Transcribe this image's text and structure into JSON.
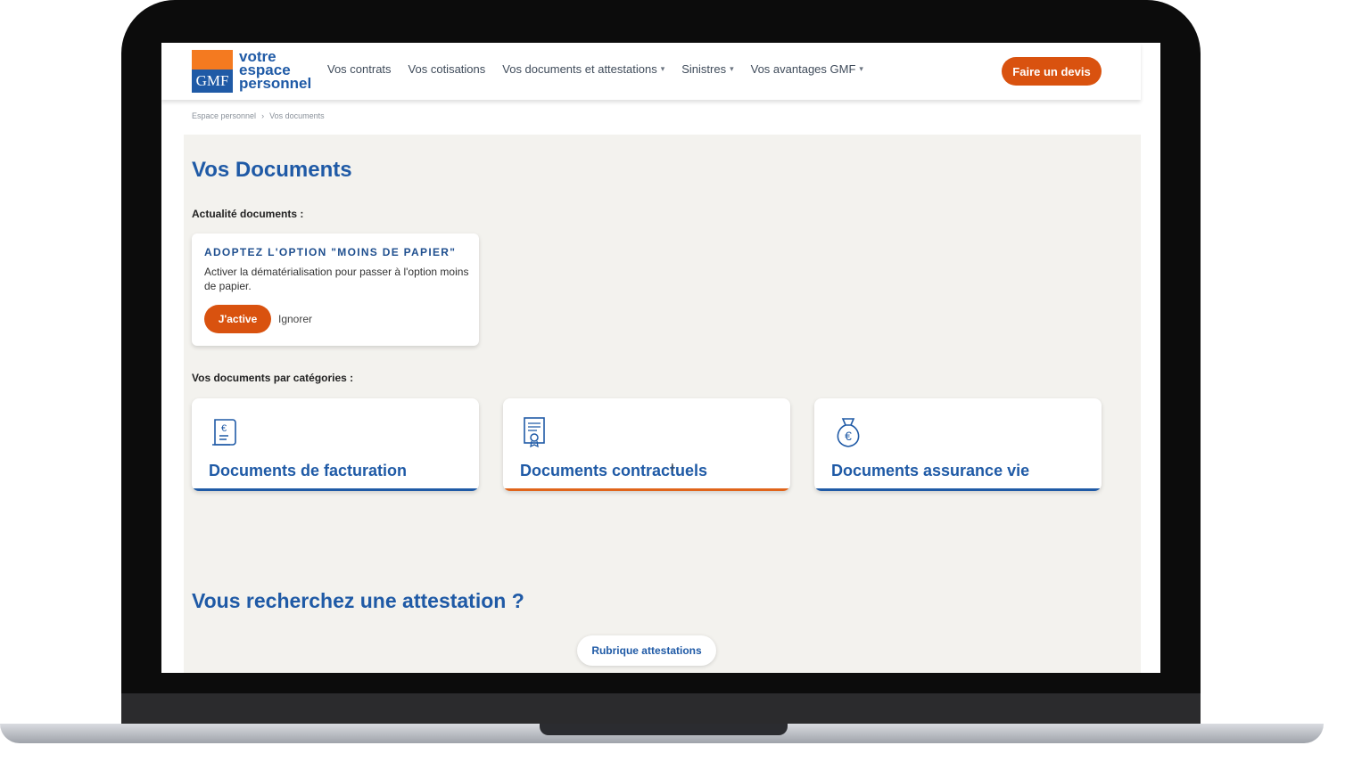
{
  "logo": {
    "brand": "GMF",
    "line1": "votre",
    "line2": "espace",
    "line3": "personnel"
  },
  "nav": [
    {
      "label": "Vos contrats",
      "dropdown": false
    },
    {
      "label": "Vos cotisations",
      "dropdown": false
    },
    {
      "label": "Vos documents et attestations",
      "dropdown": true
    },
    {
      "label": "Sinistres",
      "dropdown": true
    },
    {
      "label": "Vos avantages GMF",
      "dropdown": true
    }
  ],
  "header": {
    "cta_label": "Faire un devis"
  },
  "breadcrumb": [
    "Espace personnel",
    "Vos documents"
  ],
  "page": {
    "title": "Vos Documents",
    "news_label": "Actualité documents :",
    "categories_label": "Vos documents par catégories :"
  },
  "news_card": {
    "title": "ADOPTEZ L'OPTION \"MOINS DE PAPIER\"",
    "text": "Activer la dématérialisation pour passer à l'option moins de papier.",
    "activate_label": "J'active",
    "ignore_label": "Ignorer"
  },
  "categories": [
    {
      "label": "Documents de facturation",
      "icon": "invoice-euro-icon"
    },
    {
      "label": "Documents contractuels",
      "icon": "contract-certificate-icon"
    },
    {
      "label": "Documents assurance vie",
      "icon": "money-bag-euro-icon"
    }
  ],
  "attestation": {
    "title": "Vous recherchez une attestation ?",
    "button_label": "Rubrique attestations"
  },
  "colors": {
    "brand_blue": "#1f5aa6",
    "brand_orange": "#d9520f",
    "background": "#f3f2ee"
  }
}
